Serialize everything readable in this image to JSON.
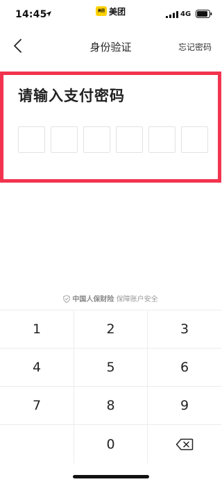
{
  "status_bar": {
    "time": "14:45",
    "app_badge": "美团",
    "app_name": "美团",
    "network": "4G"
  },
  "nav": {
    "title": "身份验证",
    "forgot_password": "忘记密码"
  },
  "password": {
    "heading": "请输入支付密码",
    "digits_entered": 0,
    "digit_count": 6
  },
  "security_hint": {
    "brand": "中国人保财险",
    "text": "保障账户安全"
  },
  "keypad": {
    "keys": [
      "1",
      "2",
      "3",
      "4",
      "5",
      "6",
      "7",
      "8",
      "9",
      "",
      "0"
    ]
  },
  "colors": {
    "highlight_border": "#f2334e",
    "brand_yellow": "#ffd100"
  }
}
